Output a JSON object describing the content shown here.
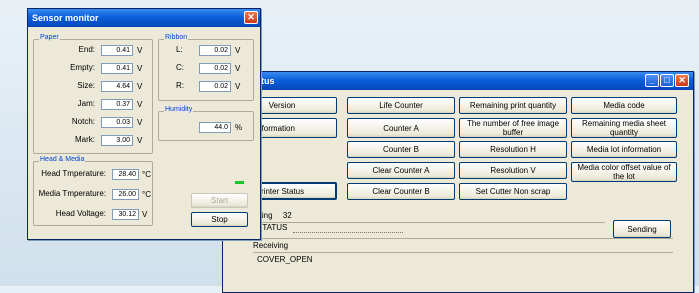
{
  "sensor_monitor": {
    "title": "Sensor monitor",
    "close_glyph": "✕",
    "paper": {
      "label": "Paper",
      "rows": [
        {
          "label": "End:",
          "value": "0.41",
          "unit": "V"
        },
        {
          "label": "Empty:",
          "value": "0.41",
          "unit": "V"
        },
        {
          "label": "Size:",
          "value": "4.64",
          "unit": "V"
        },
        {
          "label": "Jam:",
          "value": "0.37",
          "unit": "V"
        },
        {
          "label": "Notch:",
          "value": "0.03",
          "unit": "V"
        },
        {
          "label": "Mark:",
          "value": "3.00",
          "unit": "V"
        }
      ]
    },
    "ribbon": {
      "label": "Ribbon",
      "rows": [
        {
          "label": "L:",
          "value": "0.02",
          "unit": "V"
        },
        {
          "label": "C:",
          "value": "0.02",
          "unit": "V"
        },
        {
          "label": "R:",
          "value": "0.02",
          "unit": "V"
        }
      ]
    },
    "humidity": {
      "label": "Humidity",
      "value": "44.0",
      "unit": "%"
    },
    "head_media": {
      "label": "Head & Media",
      "rows": [
        {
          "label": "Head Tmperature:",
          "value": "28.40",
          "unit": "°C"
        },
        {
          "label": "Media Tmperature:",
          "value": "26.00",
          "unit": "°C"
        },
        {
          "label": "Head Voltage:",
          "value": "30.12",
          "unit": "V"
        }
      ]
    },
    "start_label": "Start",
    "stop_label": "Stop",
    "indicator_color": "#1bc42a"
  },
  "status_window": {
    "title": "tatus",
    "controls": {
      "minimize": "_",
      "maximize": "□",
      "close": "✕"
    },
    "buttons": [
      [
        "Version",
        "Life Counter",
        "Remaining print quantity",
        "Media code"
      ],
      [
        "sor information",
        "Counter A",
        "The number of free image buffer",
        "Remaining media sheet quantity"
      ],
      [
        "",
        "Counter B",
        "Resolution H",
        "Media lot information"
      ],
      [
        "",
        "Clear Counter A",
        "Resolution V",
        "Media color offset value of the lot"
      ],
      [
        "rinter Status",
        "Clear Counter B",
        "Set Cutter Non scrap",
        ""
      ]
    ],
    "sending_label": "nding",
    "sending_count": "32",
    "sending_value": "STATUS",
    "sending_button": "Sending",
    "receiving_label": "Receiving",
    "receiving_value": "COVER_OPEN"
  }
}
